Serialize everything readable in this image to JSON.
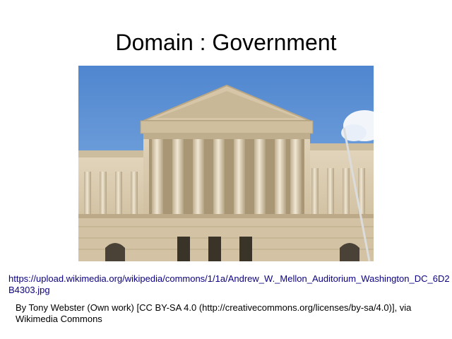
{
  "slide": {
    "title": "Domain : Government"
  },
  "image": {
    "subject": "Andrew W. Mellon Auditorium, Washington DC — neoclassical building facade with columns and pediment under blue sky"
  },
  "caption": {
    "url": "https://upload.wikimedia.org/wikipedia/commons/1/1a/Andrew_W._Mellon_Auditorium_Washington_DC_6D2B4303.jpg",
    "attribution": "By Tony Webster (Own work) [CC BY-SA 4.0 (http://creativecommons.org/licenses/by-sa/4.0)], via Wikimedia Commons"
  },
  "colors": {
    "sky": "#5a8ed0",
    "stone": "#d8c8ab",
    "link": "#0b0080"
  }
}
